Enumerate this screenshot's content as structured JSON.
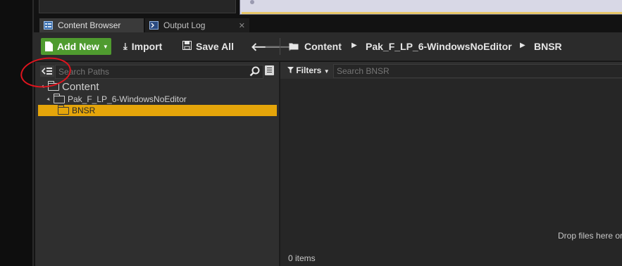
{
  "colors": {
    "accent_green": "#4f9b2f",
    "selection_orange": "#e5a50a",
    "annotation_red": "#e0141e"
  },
  "tabs": [
    {
      "label": "Content Browser",
      "icon": "content-browser-icon",
      "active": true
    },
    {
      "label": "Output Log",
      "icon": "output-log-icon",
      "active": false
    }
  ],
  "toolbar": {
    "add_new_label": "Add New",
    "import_label": "Import",
    "save_all_label": "Save All",
    "back_icon": "arrow-left-icon",
    "forward_icon": "arrow-right-icon"
  },
  "breadcrumb": [
    "Content",
    "Pak_F_LP_6-WindowsNoEditor",
    "BNSR"
  ],
  "sources": {
    "search_placeholder": "Search Paths",
    "tree": [
      {
        "label": "Content",
        "level": 0,
        "selected": false
      },
      {
        "label": "Pak_F_LP_6-WindowsNoEditor",
        "level": 1,
        "selected": false
      },
      {
        "label": "BNSR",
        "level": 2,
        "selected": true
      }
    ]
  },
  "assets": {
    "filters_label": "Filters",
    "search_placeholder": "Search BNSR",
    "drop_hint": "Drop files here or",
    "item_count": "0 items"
  }
}
